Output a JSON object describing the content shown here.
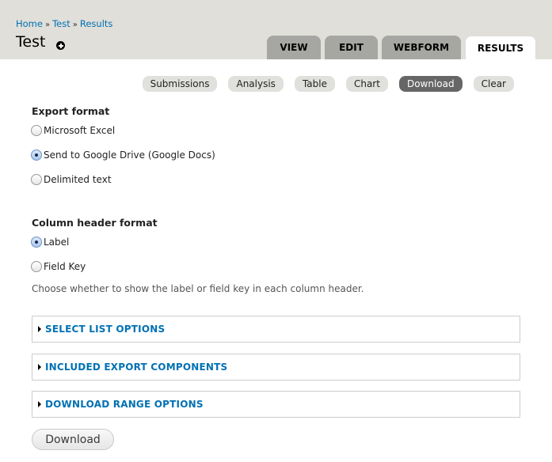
{
  "breadcrumb": [
    {
      "label": "Home"
    },
    {
      "label": "Test"
    },
    {
      "label": "Results"
    }
  ],
  "breadcrumb_separator": "»",
  "page_title": "Test",
  "primary_tabs": [
    {
      "label": "VIEW",
      "active": false
    },
    {
      "label": "EDIT",
      "active": false
    },
    {
      "label": "WEBFORM",
      "active": false
    },
    {
      "label": "RESULTS",
      "active": true
    }
  ],
  "secondary_tabs": [
    {
      "label": "Submissions",
      "active": false
    },
    {
      "label": "Analysis",
      "active": false
    },
    {
      "label": "Table",
      "active": false
    },
    {
      "label": "Chart",
      "active": false
    },
    {
      "label": "Download",
      "active": true
    },
    {
      "label": "Clear",
      "active": false
    }
  ],
  "export_format": {
    "title": "Export format",
    "options": [
      {
        "label": "Microsoft Excel",
        "checked": false
      },
      {
        "label": "Send to Google Drive (Google Docs)",
        "checked": true
      },
      {
        "label": "Delimited text",
        "checked": false
      }
    ]
  },
  "column_header_format": {
    "title": "Column header format",
    "options": [
      {
        "label": "Label",
        "checked": true
      },
      {
        "label": "Field Key",
        "checked": false
      }
    ],
    "description": "Choose whether to show the label or field key in each column header."
  },
  "fieldsets": [
    {
      "label": "SELECT LIST OPTIONS",
      "collapsed": true
    },
    {
      "label": "INCLUDED EXPORT COMPONENTS",
      "collapsed": true
    },
    {
      "label": "DOWNLOAD RANGE OPTIONS",
      "collapsed": true
    }
  ],
  "submit_label": "Download",
  "colors": {
    "link": "#0071b3",
    "header_bg": "#e0dfd9",
    "tab_inactive": "#a6a7a2",
    "subtab_active": "#666666"
  }
}
